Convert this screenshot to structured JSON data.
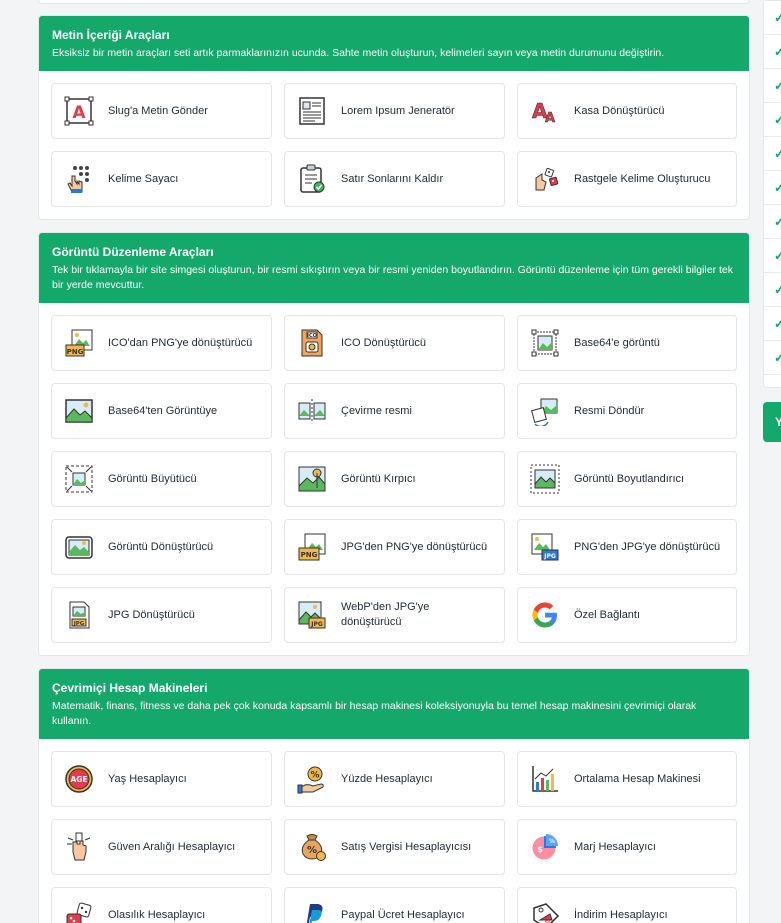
{
  "sections": [
    {
      "title": "Metin İçeriği Araçları",
      "description": "Eksiksiz bir metin araçları seti artık parmaklarınızın ucunda. Sahte metin oluşturun, kelimeleri sayın veya metin durumunu değiştirin.",
      "tools": [
        {
          "label": "Slug'a Metin Gönder",
          "icon": "text-to-slug-icon"
        },
        {
          "label": "Lorem Ipsum Jeneratör",
          "icon": "lorem-ipsum-icon"
        },
        {
          "label": "Kasa Dönüştürücü",
          "icon": "case-converter-icon"
        },
        {
          "label": "Kelime Sayacı",
          "icon": "word-counter-icon"
        },
        {
          "label": "Satır Sonlarını Kaldır",
          "icon": "clipboard-check-icon"
        },
        {
          "label": "Rastgele Kelime Oluşturucu",
          "icon": "random-word-icon"
        }
      ]
    },
    {
      "title": "Görüntü Düzenleme Araçları",
      "description": "Tek bir tıklamayla bir site simgesi oluşturun, bir resmi sıkıştırın veya bir resmi yeniden boyutlandırın. Görüntü düzenleme için tüm gerekli bilgiler tek bir yerde mevcuttur.",
      "tools": [
        {
          "label": "ICO'dan PNG'ye dönüştürücü",
          "icon": "png-file-icon"
        },
        {
          "label": "ICO Dönüştürücü",
          "icon": "ico-file-icon"
        },
        {
          "label": "Base64'e görüntü",
          "icon": "image-frame-icon"
        },
        {
          "label": "Base64'ten Görüntüye",
          "icon": "image-icon"
        },
        {
          "label": "Çevirme resmi",
          "icon": "flip-image-icon"
        },
        {
          "label": "Resmi Döndür",
          "icon": "rotate-image-icon"
        },
        {
          "label": "Görüntü Büyütücü",
          "icon": "enlarge-image-icon"
        },
        {
          "label": "Görüntü Kırpıcı",
          "icon": "crop-image-icon"
        },
        {
          "label": "Görüntü Boyutlandırıcı",
          "icon": "resize-image-icon"
        },
        {
          "label": "Görüntü Dönüştürücü",
          "icon": "convert-image-icon"
        },
        {
          "label": "JPG'den PNG'ye dönüştürücü",
          "icon": "jpg-to-png-icon"
        },
        {
          "label": "PNG'den JPG'ye dönüştürücü",
          "icon": "png-to-jpg-icon"
        },
        {
          "label": "JPG Dönüştürücü",
          "icon": "jpg-file-icon"
        },
        {
          "label": "WebP'den JPG'ye dönüştürücü",
          "icon": "webp-to-jpg-icon"
        },
        {
          "label": "Özel Bağlantı",
          "icon": "google-icon"
        }
      ]
    },
    {
      "title": "Çevrimiçi Hesap Makineleri",
      "description": "Matematik, finans, fitness ve daha pek çok konuda kapsamlı bir hesap makinesi koleksiyonuyla bu temel hesap makinesini çevrimiçi olarak kullanın.",
      "tools": [
        {
          "label": "Yaş Hesaplayıcı",
          "icon": "age-icon"
        },
        {
          "label": "Yüzde Hesaplayıcı",
          "icon": "percentage-icon"
        },
        {
          "label": "Ortalama Hesap Makinesi",
          "icon": "average-chart-icon"
        },
        {
          "label": "Güven Aralığı Hesaplayıcı",
          "icon": "confidence-icon"
        },
        {
          "label": "Satış Vergisi Hesaplayıcısı",
          "icon": "sales-tax-icon"
        },
        {
          "label": "Marj Hesaplayıcı",
          "icon": "margin-pie-icon"
        },
        {
          "label": "Olasılık Hesaplayıcı",
          "icon": "dice-icon"
        },
        {
          "label": "Paypal Ücret Hesaplayıcı",
          "icon": "paypal-icon"
        },
        {
          "label": "İndirim Hesaplayıcı",
          "icon": "discount-tag-icon"
        }
      ]
    }
  ],
  "sidebar": {
    "checks": [
      "✓",
      "✓",
      "✓",
      "✓",
      "✓",
      "✓",
      "✓",
      "✓",
      "✓",
      "✓",
      "✓"
    ],
    "button_label": "Y"
  }
}
